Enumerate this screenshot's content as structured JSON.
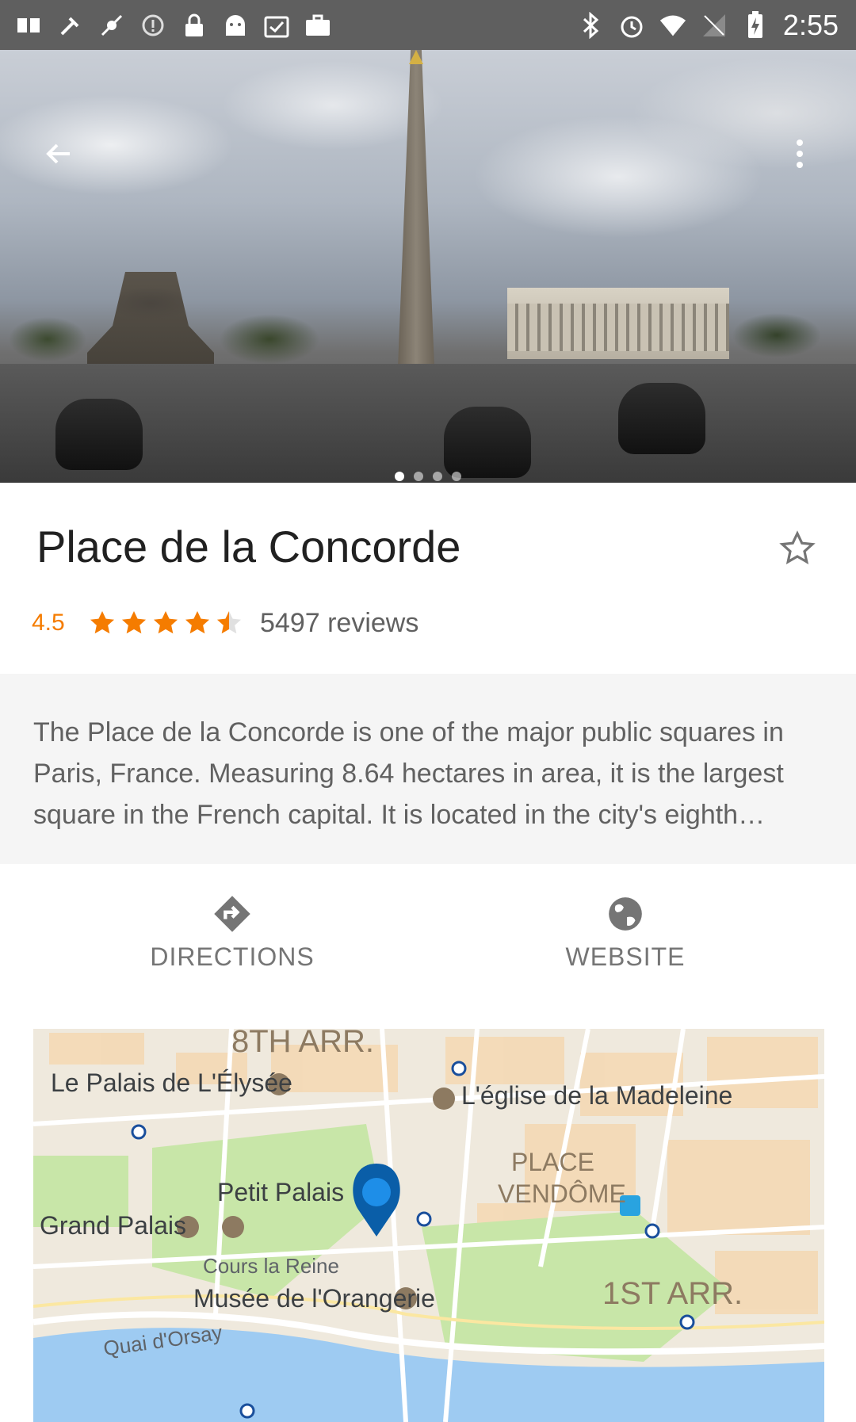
{
  "status_bar": {
    "time": "2:55",
    "left_icons": [
      "sim-icon",
      "tools-icon",
      "no-gps-icon",
      "alert-icon",
      "lock-icon",
      "android-icon",
      "clipboard-check-icon",
      "briefcase-icon"
    ],
    "right_icons": [
      "bluetooth-icon",
      "alarm-icon",
      "wifi-icon",
      "signal-icon",
      "battery-charging-icon"
    ]
  },
  "hero": {
    "page_count": 4,
    "active_page": 1
  },
  "place": {
    "title": "Place de la Concorde",
    "rating": "4.5",
    "rating_value": 4.5,
    "rating_max": 5,
    "reviews": "5497 reviews",
    "description": "The Place de la Concorde is one of the major public squares in Paris, France. Measuring 8.64 hectares in area, it is the largest square in the French capital. It is located in the city's eighth arrondissement, at the eastern end of the Champs-Élysées."
  },
  "actions": {
    "directions": "DIRECTIONS",
    "website": "WEBSITE"
  },
  "map": {
    "labels": {
      "arr8": "8TH ARR.",
      "elysee": "Le Palais de L'Élysée",
      "madeleine": "L'église de la Madeleine",
      "place_vendome_1": "PLACE",
      "place_vendome_2": "VENDÔME",
      "petit_palais": "Petit Palais",
      "grand_palais": "Grand Palais",
      "cours_la_reine": "Cours la Reine",
      "orangerie": "Musée de l'Orangerie",
      "arr1": "1ST ARR.",
      "quai_orsay": "Quai d'Orsay"
    }
  },
  "colors": {
    "accent_star": "#f57c00",
    "map_pin": "#1a73e8",
    "status_bar": "#5f5f5f"
  }
}
